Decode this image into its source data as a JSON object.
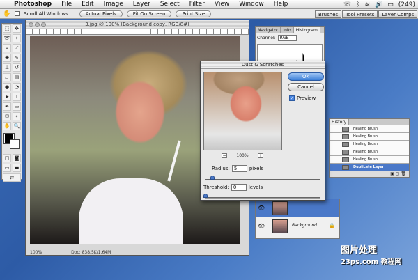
{
  "menubar": {
    "app_name": "Photoshop",
    "items": [
      "File",
      "Edit",
      "Image",
      "Layer",
      "Select",
      "Filter",
      "View",
      "Window",
      "Help"
    ],
    "battery": "(249)"
  },
  "options_bar": {
    "scroll_all_label": "Scroll All Windows",
    "actual_pixels": "Actual Pixels",
    "fit_on_screen": "Fit On Screen",
    "print_size": "Print Size"
  },
  "palette_well": {
    "tabs": [
      "Brushes",
      "Tool Presets",
      "Layer Comps"
    ]
  },
  "document": {
    "title": "3.jpg @ 100% (Background copy, RGB/8#)",
    "zoom": "100%",
    "doc_info": "Doc: 838.5K/1.64M"
  },
  "navigator_panel": {
    "tabs": [
      "Navigator",
      "Info",
      "Histogram"
    ],
    "channel_label": "Channel:",
    "channel_value": "RGB"
  },
  "history_panel": {
    "tab": "History",
    "items": [
      "Healing Brush",
      "Healing Brush",
      "Healing Brush",
      "Healing Brush",
      "Healing Brush",
      "Duplicate Layer"
    ]
  },
  "layers_panel": {
    "layers": [
      {
        "name": ""
      },
      {
        "name": "Background"
      }
    ]
  },
  "dialog": {
    "title": "Dust & Scratches",
    "ok": "OK",
    "cancel": "Cancel",
    "preview_label": "Preview",
    "preview_checked": true,
    "zoom_level": "100%",
    "zoom_out": "−",
    "zoom_in": "+",
    "radius_label": "Radius:",
    "radius_value": "5",
    "radius_unit": "pixels",
    "threshold_label": "Threshold:",
    "threshold_value": "0",
    "threshold_unit": "levels"
  },
  "watermark": {
    "line1": "图片处理",
    "line2": "23ps.com 教程网"
  },
  "colors": {
    "accent": "#3d80d8",
    "selection": "#4a78c8"
  }
}
